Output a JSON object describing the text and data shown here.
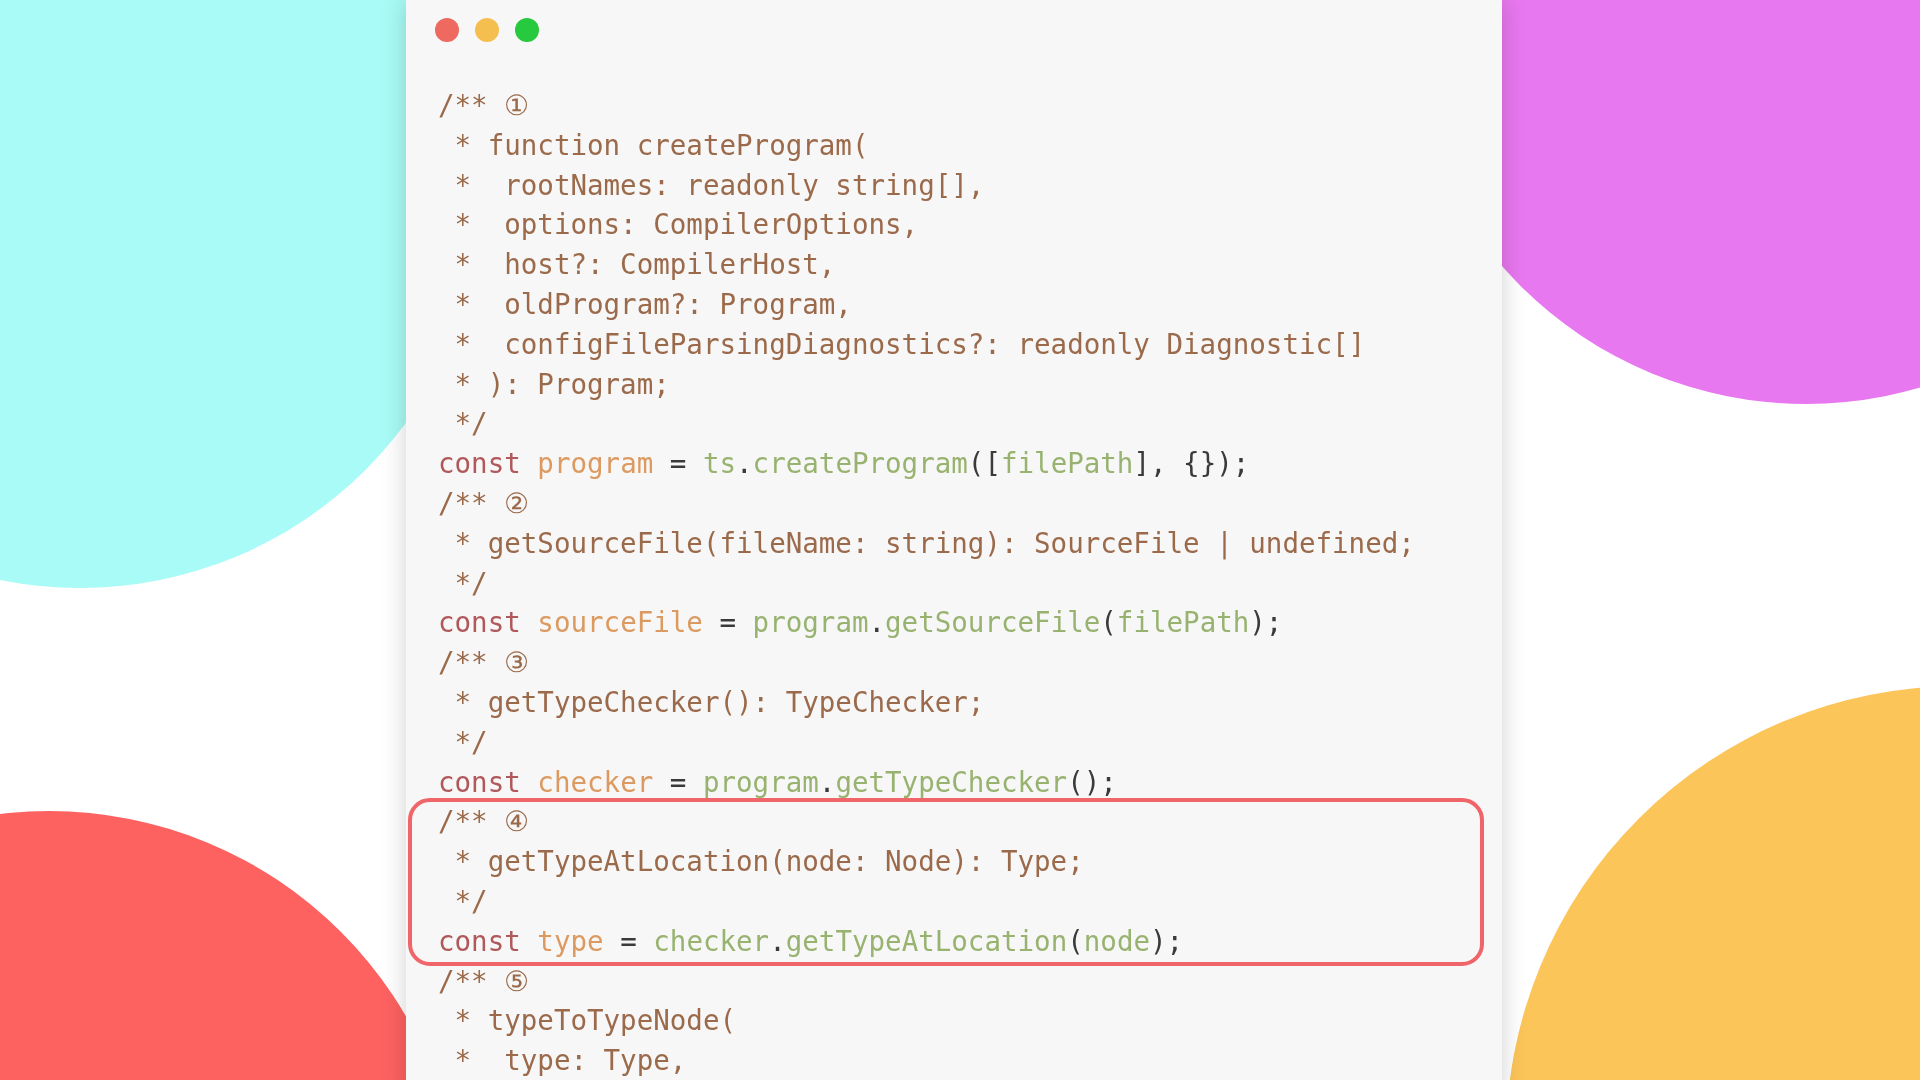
{
  "window": {
    "controls": [
      {
        "kind": "close"
      },
      {
        "kind": "minimize"
      },
      {
        "kind": "maximize"
      }
    ]
  },
  "blocks": [
    {
      "highlighted": false,
      "lines": [
        [
          {
            "kind": "comment",
            "text": "/** ①"
          }
        ],
        [
          {
            "kind": "comment",
            "text": " * function createProgram("
          }
        ],
        [
          {
            "kind": "comment",
            "text": " *  rootNames: readonly string[],"
          }
        ],
        [
          {
            "kind": "comment",
            "text": " *  options: CompilerOptions,"
          }
        ],
        [
          {
            "kind": "comment",
            "text": " *  host?: CompilerHost,"
          }
        ],
        [
          {
            "kind": "comment",
            "text": " *  oldProgram?: Program,"
          }
        ],
        [
          {
            "kind": "comment",
            "text": " *  configFileParsingDiagnostics?: readonly Diagnostic[]"
          }
        ],
        [
          {
            "kind": "comment",
            "text": " * ): Program;"
          }
        ],
        [
          {
            "kind": "comment",
            "text": " */"
          }
        ],
        [
          {
            "kind": "keyword",
            "text": "const"
          },
          {
            "kind": "variable",
            "text": " program"
          },
          {
            "kind": "punct",
            "text": " = "
          },
          {
            "kind": "call",
            "text": "ts"
          },
          {
            "kind": "punct",
            "text": "."
          },
          {
            "kind": "call",
            "text": "createProgram"
          },
          {
            "kind": "punct",
            "text": "(["
          },
          {
            "kind": "call",
            "text": "filePath"
          },
          {
            "kind": "punct",
            "text": "], {});"
          }
        ]
      ]
    },
    {
      "highlighted": false,
      "lines": [
        [
          {
            "kind": "comment",
            "text": "/** ②"
          }
        ],
        [
          {
            "kind": "comment",
            "text": " * getSourceFile(fileName: string): SourceFile | undefined;"
          }
        ],
        [
          {
            "kind": "comment",
            "text": " */"
          }
        ],
        [
          {
            "kind": "keyword",
            "text": "const"
          },
          {
            "kind": "variable",
            "text": " sourceFile"
          },
          {
            "kind": "punct",
            "text": " = "
          },
          {
            "kind": "call",
            "text": "program"
          },
          {
            "kind": "punct",
            "text": "."
          },
          {
            "kind": "call",
            "text": "getSourceFile"
          },
          {
            "kind": "punct",
            "text": "("
          },
          {
            "kind": "call",
            "text": "filePath"
          },
          {
            "kind": "punct",
            "text": ");"
          }
        ]
      ]
    },
    {
      "highlighted": false,
      "lines": [
        [
          {
            "kind": "comment",
            "text": "/** ③"
          }
        ],
        [
          {
            "kind": "comment",
            "text": " * getTypeChecker(): TypeChecker;"
          }
        ],
        [
          {
            "kind": "comment",
            "text": " */"
          }
        ],
        [
          {
            "kind": "keyword",
            "text": "const"
          },
          {
            "kind": "variable",
            "text": " checker"
          },
          {
            "kind": "punct",
            "text": " = "
          },
          {
            "kind": "call",
            "text": "program"
          },
          {
            "kind": "punct",
            "text": "."
          },
          {
            "kind": "call",
            "text": "getTypeChecker"
          },
          {
            "kind": "punct",
            "text": "();"
          }
        ]
      ]
    },
    {
      "highlighted": true,
      "lines": [
        [
          {
            "kind": "comment",
            "text": "/** ④"
          }
        ],
        [
          {
            "kind": "comment",
            "text": " * getTypeAtLocation(node: Node): Type;"
          }
        ],
        [
          {
            "kind": "comment",
            "text": " */"
          }
        ],
        [
          {
            "kind": "keyword",
            "text": "const"
          },
          {
            "kind": "variable",
            "text": " type"
          },
          {
            "kind": "punct",
            "text": " = "
          },
          {
            "kind": "call",
            "text": "checker"
          },
          {
            "kind": "punct",
            "text": "."
          },
          {
            "kind": "call",
            "text": "getTypeAtLocation"
          },
          {
            "kind": "punct",
            "text": "("
          },
          {
            "kind": "call",
            "text": "node"
          },
          {
            "kind": "punct",
            "text": ");"
          }
        ]
      ]
    },
    {
      "highlighted": false,
      "lines": [
        [
          {
            "kind": "comment",
            "text": "/** ⑤"
          }
        ],
        [
          {
            "kind": "comment",
            "text": " * typeToTypeNode("
          }
        ],
        [
          {
            "kind": "comment",
            "text": " *  type: Type,"
          }
        ]
      ]
    }
  ]
}
